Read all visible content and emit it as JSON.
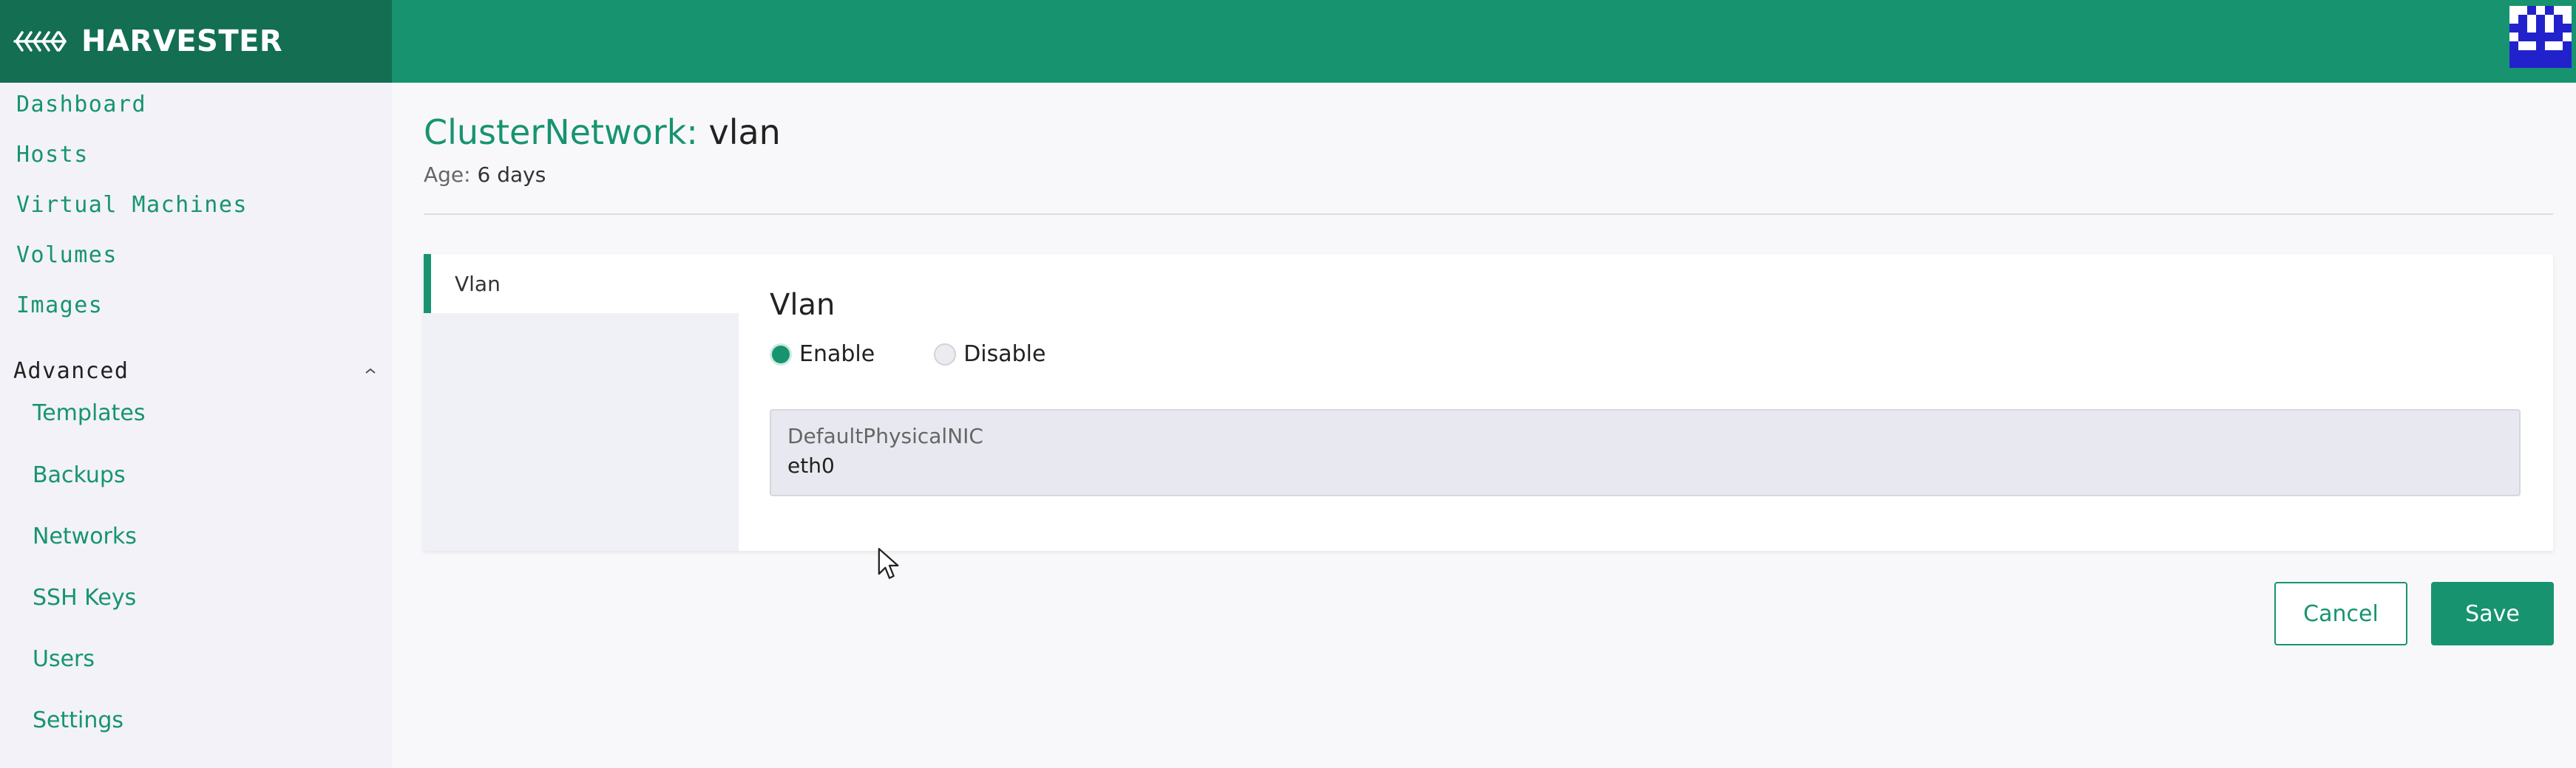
{
  "header": {
    "brand": "HARVESTER",
    "colors": {
      "header": "#17946f",
      "brand_bg": "#136e52",
      "accent": "#17946f"
    }
  },
  "sidebar": {
    "items": [
      {
        "label": "Dashboard"
      },
      {
        "label": "Hosts"
      },
      {
        "label": "Virtual Machines"
      },
      {
        "label": "Volumes"
      },
      {
        "label": "Images"
      }
    ],
    "group": {
      "label": "Advanced",
      "icon": "chevron-up-icon",
      "items": [
        {
          "label": "Templates"
        },
        {
          "label": "Backups"
        },
        {
          "label": "Networks"
        },
        {
          "label": "SSH Keys"
        },
        {
          "label": "Users"
        },
        {
          "label": "Settings"
        }
      ]
    }
  },
  "page": {
    "title_key": "ClusterNetwork:",
    "title_value": "vlan",
    "age_key": "Age:",
    "age_value": "6 days"
  },
  "tabs": [
    {
      "label": "Vlan"
    }
  ],
  "section": {
    "title": "Vlan",
    "radio": {
      "options": [
        "Enable",
        "Disable"
      ],
      "selected": "Enable"
    },
    "field": {
      "label": "DefaultPhysicalNIC",
      "value": "eth0"
    }
  },
  "buttons": {
    "cancel": "Cancel",
    "save": "Save"
  }
}
